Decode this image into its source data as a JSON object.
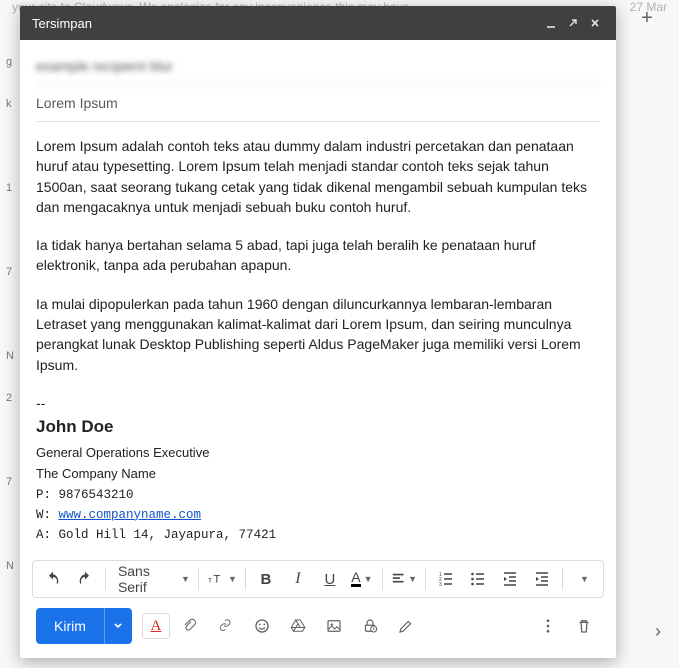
{
  "background": {
    "snippet": "your site to Cloudways. We apologize for any inconvenience this may have",
    "date": "27 Mar"
  },
  "left_edge": [
    "g",
    "k",
    "",
    "1",
    "",
    "7",
    "",
    "N",
    "2",
    "",
    "7",
    "",
    "N"
  ],
  "window": {
    "title": "Tersimpan",
    "minimize_tip": "Minimize",
    "maximize_tip": "Full screen",
    "close_tip": "Save & close"
  },
  "headers": {
    "to": "example recipient blur",
    "subject": "Lorem Ipsum"
  },
  "body": {
    "p1": "Lorem Ipsum adalah contoh teks atau dummy dalam industri percetakan dan penataan huruf atau typesetting. Lorem Ipsum telah menjadi standar contoh teks sejak tahun 1500an, saat seorang tukang cetak yang tidak dikenal mengambil sebuah kumpulan teks dan mengacaknya untuk menjadi sebuah buku contoh huruf.",
    "p2": "Ia tidak hanya bertahan selama 5 abad, tapi juga telah beralih ke penataan huruf elektronik, tanpa ada perubahan apapun.",
    "p3": "Ia mulai dipopulerkan pada tahun 1960 dengan diluncurkannya lembaran-lembaran Letraset yang menggunakan kalimat-kalimat dari Lorem Ipsum, dan seiring munculnya perangkat lunak Desktop Publishing seperti Aldus PageMaker juga memiliki versi Lorem Ipsum."
  },
  "signature": {
    "separator": "--",
    "name": "John Doe",
    "role": "General Operations Executive",
    "company": "The Company Name",
    "phone_label": "P:",
    "phone": "9876543210",
    "web_label": "W:",
    "web": "www.companyname.com",
    "addr_label": "A:",
    "addr": "Gold Hill 14, Jayapura, 77421"
  },
  "format": {
    "undo": "Undo",
    "redo": "Redo",
    "font": "Sans Serif",
    "size": "Size",
    "bold": "B",
    "italic": "I",
    "underline": "U",
    "color": "A",
    "align": "Align",
    "numbered_list": "Numbered list",
    "bulleted_list": "Bulleted list",
    "indent_less": "Indent less",
    "indent_more": "Indent more",
    "more": "More formatting"
  },
  "actions": {
    "send": "Kirim",
    "format_toggle": "Formatting options",
    "attach": "Attach files",
    "link": "Insert link",
    "emoji": "Insert emoji",
    "drive": "Insert from Drive",
    "photo": "Insert photo",
    "confidential": "Toggle confidential mode",
    "pen": "Insert signature",
    "more": "More options",
    "discard": "Discard draft"
  },
  "outside": {
    "add_tab": "+",
    "next": "›"
  }
}
